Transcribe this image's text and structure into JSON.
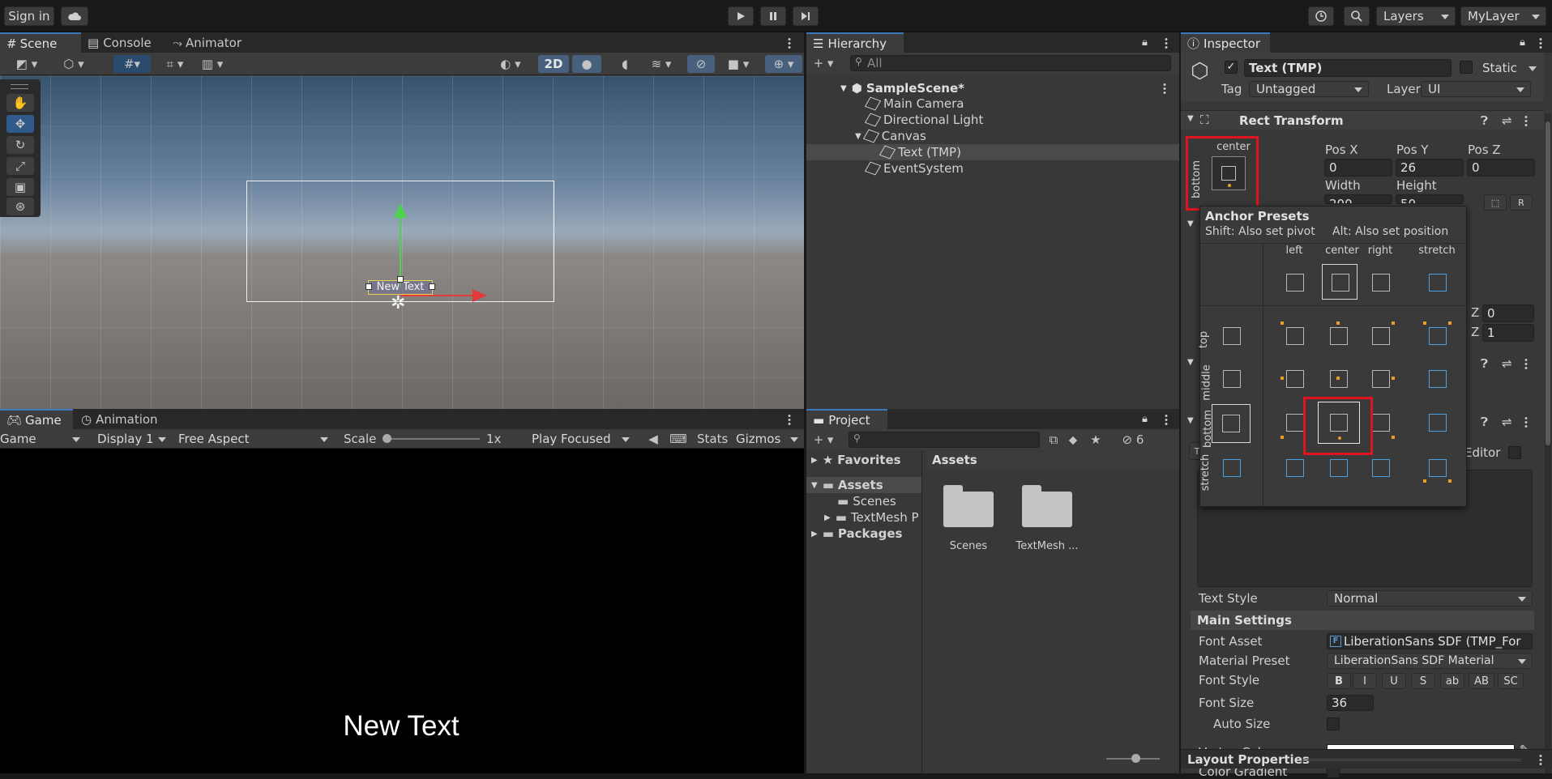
{
  "toolbar": {
    "sign_in": "Sign in",
    "layers": "Layers",
    "layout": "MyLayer",
    "icons": [
      "cloud-icon",
      "play-icon",
      "pause-icon",
      "step-icon",
      "history-icon",
      "search-icon"
    ]
  },
  "scene_panel": {
    "tabs": [
      "Scene",
      "Console",
      "Animator"
    ],
    "toggle_2d": "2D",
    "object_label": "New Text",
    "icons": [
      "hand-tool-icon",
      "move-tool-icon",
      "rotate-tool-icon",
      "scale-tool-icon",
      "rect-tool-icon",
      "transform-tool-icon"
    ]
  },
  "game_panel": {
    "tabs": [
      "Game",
      "Animation"
    ],
    "mode": "Game",
    "display": "Display 1",
    "aspect": "Free Aspect",
    "scale_label": "Scale",
    "scale_value": "1x",
    "play_mode": "Play Focused",
    "stats": "Stats",
    "gizmos": "Gizmos",
    "game_text": "New Text"
  },
  "hierarchy": {
    "title": "Hierarchy",
    "search_placeholder": "All",
    "items": [
      {
        "label": "SampleScene*",
        "depth": 0
      },
      {
        "label": "Main Camera",
        "depth": 1
      },
      {
        "label": "Directional Light",
        "depth": 1
      },
      {
        "label": "Canvas",
        "depth": 1
      },
      {
        "label": "Text (TMP)",
        "depth": 2
      },
      {
        "label": "EventSystem",
        "depth": 1
      }
    ]
  },
  "project": {
    "title": "Project",
    "hidden_count": "6",
    "tree": [
      "Favorites",
      "Assets",
      "Scenes",
      "TextMesh P",
      "Packages"
    ],
    "breadcrumb": "Assets",
    "assets": [
      "Scenes",
      "TextMesh ..."
    ]
  },
  "inspector": {
    "title": "Inspector",
    "object_name": "Text (TMP)",
    "static_label": "Static",
    "tag_label": "Tag",
    "tag_value": "Untagged",
    "layer_label": "Layer",
    "layer_value": "UI",
    "rect_transform": "Rect Transform",
    "anchor_top": "center",
    "anchor_side": "bottom",
    "pos_x_label": "Pos X",
    "pos_y_label": "Pos Y",
    "pos_z_label": "Pos Z",
    "pos_x": "0",
    "pos_y": "26",
    "pos_z": "0",
    "width_label": "Width",
    "height_label": "Height",
    "width": "200",
    "height": "50",
    "z_label": "Z",
    "z1": "0",
    "z2": "1",
    "editor_label": "Editor",
    "text_style_label": "Text Style",
    "text_style_value": "Normal",
    "main_settings": "Main Settings",
    "font_asset_label": "Font Asset",
    "font_asset_value": "LiberationSans SDF (TMP_For",
    "material_preset_label": "Material Preset",
    "material_preset_value": "LiberationSans SDF Material",
    "font_style_label": "Font Style",
    "font_style_buttons": [
      "B",
      "I",
      "U",
      "S",
      "ab",
      "AB",
      "SC"
    ],
    "font_size_label": "Font Size",
    "font_size_value": "36",
    "auto_size_label": "Auto Size",
    "vertex_color_label": "Vertex Color",
    "color_gradient_label": "Color Gradient",
    "layout_properties": "Layout Properties"
  },
  "anchor_presets": {
    "title": "Anchor Presets",
    "shift_hint": "Shift: Also set pivot",
    "alt_hint": "Alt: Also set position",
    "columns": [
      "left",
      "center",
      "right",
      "stretch"
    ],
    "rows": [
      "top",
      "middle",
      "bottom",
      "stretch"
    ]
  },
  "colors": {
    "accent": "#3a79bb",
    "highlight": "#e0141e",
    "anchor_dot": "#e8a020"
  }
}
